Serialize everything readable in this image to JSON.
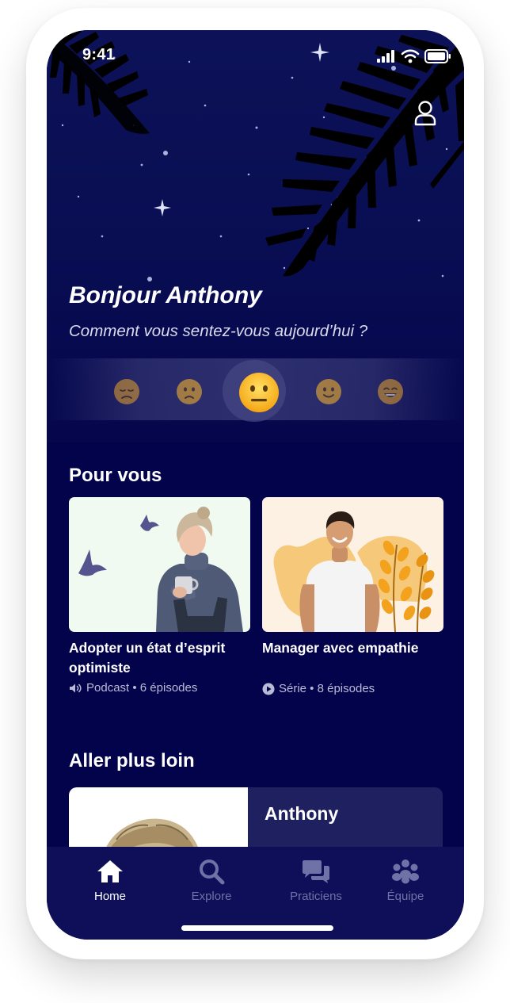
{
  "status_bar": {
    "time": "9:41",
    "icons": [
      "cellular-signal-icon",
      "wifi-icon",
      "battery-icon"
    ]
  },
  "header": {
    "profile_icon": "user-icon",
    "greeting": "Bonjour Anthony",
    "mood_question": "Comment vous sentez-vous aujourd’hui ?"
  },
  "mood_selector": {
    "options": [
      "sad-face",
      "slightly-frowning-face",
      "neutral-face",
      "slightly-smiling-face",
      "grinning-face"
    ],
    "selected_index": 2
  },
  "for_you": {
    "title": "Pour vous",
    "cards": [
      {
        "title": "Adopter un état d’esprit optimiste",
        "meta_icon": "speaker-icon",
        "meta": "Podcast • 6 épisodes"
      },
      {
        "title": "Manager avec empathie",
        "meta_icon": "play-circle-icon",
        "meta": "Série • 8 épisodes"
      }
    ]
  },
  "go_further": {
    "title": "Aller plus loin",
    "card": {
      "name": "Anthony"
    }
  },
  "tab_bar": {
    "tabs": [
      {
        "label": "Home",
        "icon": "home-icon",
        "active": true
      },
      {
        "label": "Explore",
        "icon": "search-icon",
        "active": false
      },
      {
        "label": "Praticiens",
        "icon": "chat-bubbles-icon",
        "active": false
      },
      {
        "label": "Équipe",
        "icon": "team-icon",
        "active": false
      }
    ]
  },
  "colors": {
    "background": "#03034c",
    "sky_top": "#0d1258",
    "tab_bar": "#0e0f58",
    "tab_inactive": "#6e72a6",
    "card_1_bg": "#f0faf0",
    "card_2_bg": "#fdf1e4",
    "accent_orange": "#f2a21c"
  }
}
